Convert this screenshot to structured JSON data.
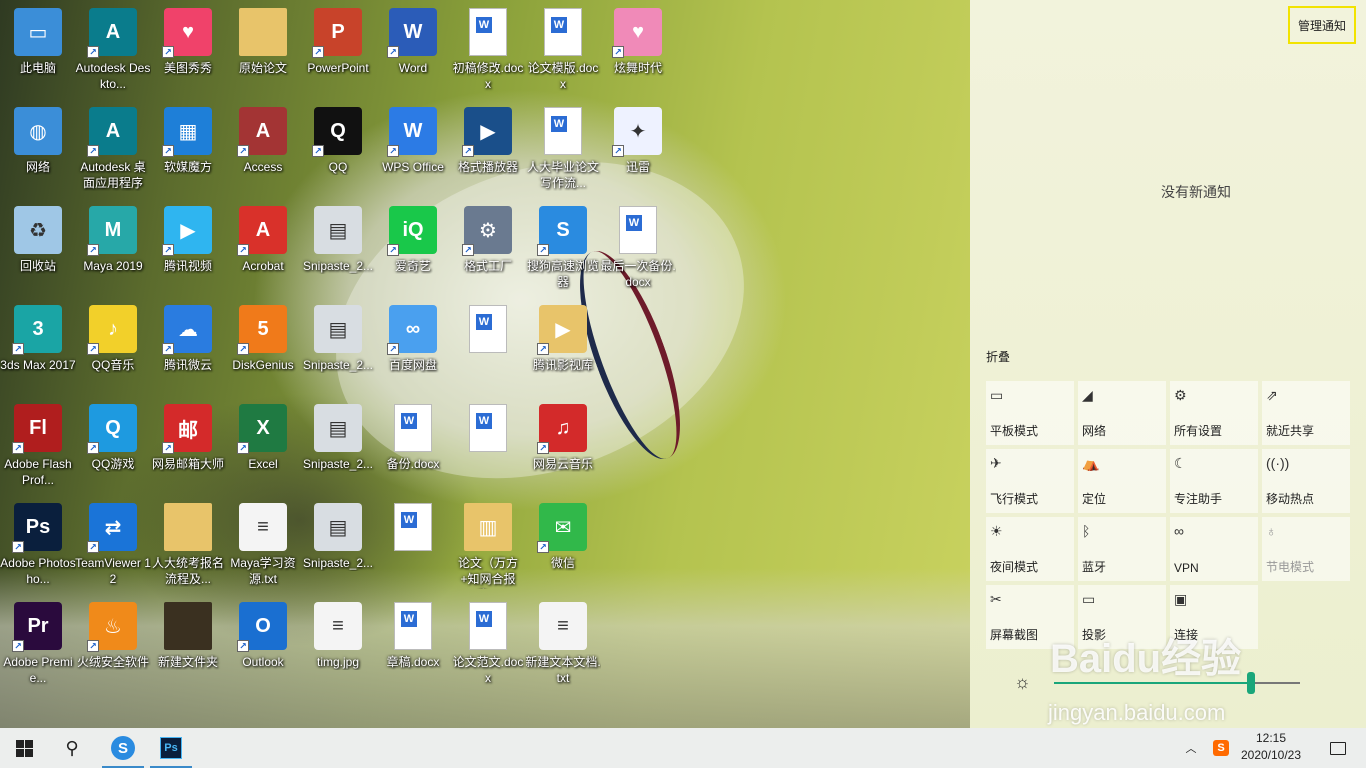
{
  "desktop_icons": [
    {
      "label": "此电脑",
      "col": 0,
      "row": 0,
      "kind": "pc"
    },
    {
      "label": "Autodesk Deskto...",
      "col": 1,
      "row": 0,
      "kind": "autodesk",
      "shortcut": true
    },
    {
      "label": "美图秀秀",
      "col": 2,
      "row": 0,
      "kind": "meitu",
      "shortcut": true
    },
    {
      "label": "原始论文",
      "col": 3,
      "row": 0,
      "kind": "folder"
    },
    {
      "label": "PowerPoint",
      "col": 4,
      "row": 0,
      "kind": "ppt",
      "shortcut": true
    },
    {
      "label": "Word",
      "col": 5,
      "row": 0,
      "kind": "word",
      "shortcut": true
    },
    {
      "label": "初稿修改.docx",
      "col": 6,
      "row": 0,
      "kind": "doc"
    },
    {
      "label": "论文模版.docx",
      "col": 7,
      "row": 0,
      "kind": "doc"
    },
    {
      "label": "炫舞时代",
      "col": 8,
      "row": 0,
      "kind": "heart",
      "shortcut": true
    },
    {
      "label": "网络",
      "col": 0,
      "row": 1,
      "kind": "network"
    },
    {
      "label": "Autodesk 桌面应用程序",
      "col": 1,
      "row": 1,
      "kind": "autodesk",
      "shortcut": true
    },
    {
      "label": "软媒魔方",
      "col": 2,
      "row": 1,
      "kind": "cube",
      "shortcut": true
    },
    {
      "label": "Access",
      "col": 3,
      "row": 1,
      "kind": "access",
      "shortcut": true
    },
    {
      "label": "QQ",
      "col": 4,
      "row": 1,
      "kind": "qq",
      "shortcut": true
    },
    {
      "label": "WPS Office",
      "col": 5,
      "row": 1,
      "kind": "wps",
      "shortcut": true
    },
    {
      "label": "格式播放器",
      "col": 6,
      "row": 1,
      "kind": "player",
      "shortcut": true
    },
    {
      "label": "人大毕业论文写作流...",
      "col": 7,
      "row": 1,
      "kind": "doc"
    },
    {
      "label": "迅雷",
      "col": 8,
      "row": 1,
      "kind": "xunlei",
      "shortcut": true
    },
    {
      "label": "回收站",
      "col": 0,
      "row": 2,
      "kind": "recycle"
    },
    {
      "label": "Maya 2019",
      "col": 1,
      "row": 2,
      "kind": "maya",
      "shortcut": true
    },
    {
      "label": "腾讯视频",
      "col": 2,
      "row": 2,
      "kind": "txvideo",
      "shortcut": true
    },
    {
      "label": "Acrobat",
      "col": 3,
      "row": 2,
      "kind": "acrobat",
      "shortcut": true
    },
    {
      "label": "Snipaste_2...",
      "col": 4,
      "row": 2,
      "kind": "image"
    },
    {
      "label": "爱奇艺",
      "col": 5,
      "row": 2,
      "kind": "iqiyi",
      "shortcut": true
    },
    {
      "label": "格式工厂",
      "col": 6,
      "row": 2,
      "kind": "factory",
      "shortcut": true
    },
    {
      "label": "搜狗高速浏览器",
      "col": 7,
      "row": 2,
      "kind": "sogou",
      "shortcut": true
    },
    {
      "label": "最后一次备份.docx",
      "col": 8,
      "row": 2,
      "kind": "doc"
    },
    {
      "label": "3ds Max 2017",
      "col": 0,
      "row": 3,
      "kind": "max",
      "shortcut": true
    },
    {
      "label": "QQ音乐",
      "col": 1,
      "row": 3,
      "kind": "qqmusic",
      "shortcut": true
    },
    {
      "label": "腾讯微云",
      "col": 2,
      "row": 3,
      "kind": "weiyun",
      "shortcut": true
    },
    {
      "label": "DiskGenius",
      "col": 3,
      "row": 3,
      "kind": "diskgenius",
      "shortcut": true
    },
    {
      "label": "Snipaste_2...",
      "col": 4,
      "row": 3,
      "kind": "image"
    },
    {
      "label": "百度网盘",
      "col": 5,
      "row": 3,
      "kind": "baidupan",
      "shortcut": true
    },
    {
      "label": "",
      "col": 6,
      "row": 3,
      "kind": "doc"
    },
    {
      "label": "腾讯影视库",
      "col": 7,
      "row": 3,
      "kind": "folder-video",
      "shortcut": true
    },
    {
      "label": "Adobe Flash Prof...",
      "col": 0,
      "row": 4,
      "kind": "flash",
      "shortcut": true
    },
    {
      "label": "QQ游戏",
      "col": 1,
      "row": 4,
      "kind": "qqgame",
      "shortcut": true
    },
    {
      "label": "网易邮箱大师",
      "col": 2,
      "row": 4,
      "kind": "mail",
      "shortcut": true
    },
    {
      "label": "Excel",
      "col": 3,
      "row": 4,
      "kind": "excel",
      "shortcut": true
    },
    {
      "label": "Snipaste_2...",
      "col": 4,
      "row": 4,
      "kind": "image"
    },
    {
      "label": "备份.docx",
      "col": 5,
      "row": 4,
      "kind": "doc"
    },
    {
      "label": "",
      "col": 6,
      "row": 4,
      "kind": "doc"
    },
    {
      "label": "网易云音乐",
      "col": 7,
      "row": 4,
      "kind": "netease",
      "shortcut": true
    },
    {
      "label": "Adobe Photosho...",
      "col": 0,
      "row": 5,
      "kind": "ps",
      "shortcut": true
    },
    {
      "label": "TeamViewer 12",
      "col": 1,
      "row": 5,
      "kind": "teamviewer",
      "shortcut": true
    },
    {
      "label": "人大统考报名流程及...",
      "col": 2,
      "row": 5,
      "kind": "folder"
    },
    {
      "label": "Maya学习资源.txt",
      "col": 3,
      "row": 5,
      "kind": "txt"
    },
    {
      "label": "Snipaste_2...",
      "col": 4,
      "row": 5,
      "kind": "image"
    },
    {
      "label": "",
      "col": 5,
      "row": 5,
      "kind": "doc"
    },
    {
      "label": "论文（万方+知网合报告...",
      "col": 6,
      "row": 5,
      "kind": "zip"
    },
    {
      "label": "微信",
      "col": 7,
      "row": 5,
      "kind": "wechat",
      "shortcut": true
    },
    {
      "label": "Adobe Premie...",
      "col": 0,
      "row": 6,
      "kind": "pr",
      "shortcut": true
    },
    {
      "label": "火绒安全软件",
      "col": 1,
      "row": 6,
      "kind": "huorong",
      "shortcut": true
    },
    {
      "label": "新建文件夹",
      "col": 2,
      "row": 6,
      "kind": "folder-dark"
    },
    {
      "label": "Outlook",
      "col": 3,
      "row": 6,
      "kind": "outlook",
      "shortcut": true
    },
    {
      "label": "timg.jpg",
      "col": 4,
      "row": 6,
      "kind": "txt"
    },
    {
      "label": "章稿.docx",
      "col": 5,
      "row": 6,
      "kind": "doc"
    },
    {
      "label": "论文范文.docx",
      "col": 6,
      "row": 6,
      "kind": "doc"
    },
    {
      "label": "新建文本文档.txt",
      "col": 7,
      "row": 6,
      "kind": "txt"
    }
  ],
  "action_center": {
    "manage_label": "管理通知",
    "no_notifications": "没有新通知",
    "collapse_label": "折叠",
    "tiles": [
      {
        "label": "平板模式",
        "icon": "▭",
        "col": 0,
        "row": 0,
        "enabled": true
      },
      {
        "label": "网络",
        "icon": "◢",
        "col": 1,
        "row": 0,
        "enabled": true
      },
      {
        "label": "所有设置",
        "icon": "⚙",
        "col": 2,
        "row": 0,
        "enabled": true
      },
      {
        "label": "就近共享",
        "icon": "⇗",
        "col": 3,
        "row": 0,
        "enabled": true
      },
      {
        "label": "飞行模式",
        "icon": "✈",
        "col": 0,
        "row": 1,
        "enabled": true
      },
      {
        "label": "定位",
        "icon": "⛺",
        "col": 1,
        "row": 1,
        "enabled": true
      },
      {
        "label": "专注助手",
        "icon": "☾",
        "col": 2,
        "row": 1,
        "enabled": true
      },
      {
        "label": "移动热点",
        "icon": "((·))",
        "col": 3,
        "row": 1,
        "enabled": true
      },
      {
        "label": "夜间模式",
        "icon": "☀",
        "col": 0,
        "row": 2,
        "enabled": true
      },
      {
        "label": "蓝牙",
        "icon": "ᛒ",
        "col": 1,
        "row": 2,
        "enabled": true
      },
      {
        "label": "VPN",
        "icon": "∞",
        "col": 2,
        "row": 2,
        "enabled": true
      },
      {
        "label": "节电模式",
        "icon": "♁",
        "col": 3,
        "row": 2,
        "enabled": false
      },
      {
        "label": "屏幕截图",
        "icon": "✂",
        "col": 0,
        "row": 3,
        "enabled": true
      },
      {
        "label": "投影",
        "icon": "▭",
        "col": 1,
        "row": 3,
        "enabled": true
      },
      {
        "label": "连接",
        "icon": "▣",
        "col": 2,
        "row": 3,
        "enabled": true
      }
    ],
    "brightness_icon": "brightness-icon",
    "brightness_level": 0.8
  },
  "taskbar": {
    "time": "12:15",
    "date": "2020/10/23",
    "ime_label": "S"
  },
  "watermark": {
    "text": "Baidu经验",
    "url": "jingyan.baidu.com"
  }
}
